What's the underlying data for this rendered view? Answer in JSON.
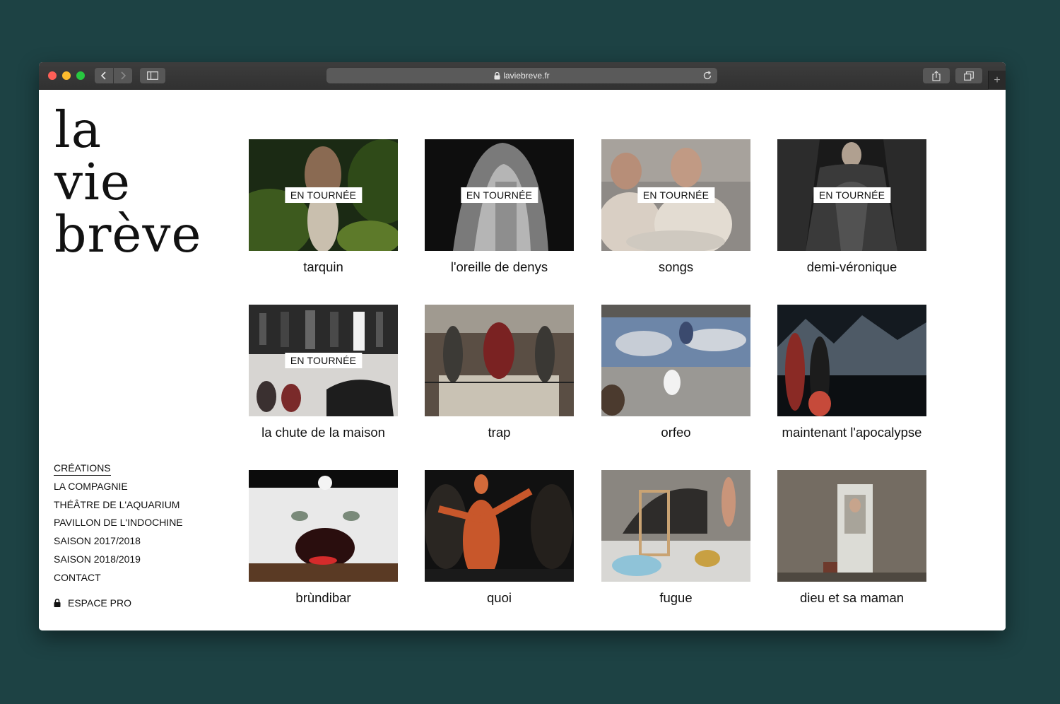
{
  "browser": {
    "url": "laviebreve.fr"
  },
  "site": {
    "logo_lines": [
      "la",
      "vie",
      "brève"
    ]
  },
  "nav": {
    "items": [
      {
        "label": "CRÉATIONS",
        "active": true
      },
      {
        "label": "LA COMPAGNIE"
      },
      {
        "label": "THÉÂTRE DE L'AQUARIUM"
      },
      {
        "label": "PAVILLON DE L'INDOCHINE"
      },
      {
        "label": "SAISON 2017/2018"
      },
      {
        "label": "SAISON 2018/2019"
      },
      {
        "label": "CONTACT"
      }
    ],
    "espace_pro": "ESPACE PRO"
  },
  "creations": [
    {
      "title": "tarquin",
      "badge": "EN TOURNÉE"
    },
    {
      "title": "l'oreille de denys",
      "badge": "EN TOURNÉE"
    },
    {
      "title": "songs",
      "badge": "EN TOURNÉE"
    },
    {
      "title": "demi-véronique",
      "badge": "EN TOURNÉE"
    },
    {
      "title": "la chute de la maison",
      "badge": "EN TOURNÉE"
    },
    {
      "title": "trap"
    },
    {
      "title": "orfeo"
    },
    {
      "title": "maintenant l'apocalypse"
    },
    {
      "title": "brùndibar"
    },
    {
      "title": "quoi"
    },
    {
      "title": "fugue"
    },
    {
      "title": "dieu et sa maman"
    }
  ],
  "colors": {
    "desktop": "#1d4244",
    "text": "#111111"
  }
}
